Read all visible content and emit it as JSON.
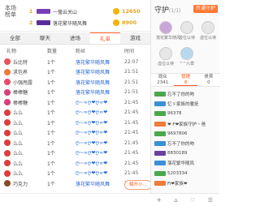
{
  "rank": {
    "title": "本场 榜单",
    "rows": [
      {
        "rank": "1",
        "name": "一憧云关山",
        "score": "12650",
        "badge_color": "#7a3db8"
      },
      {
        "rank": "2",
        "name": "落花繁华随风舞",
        "score": "8900",
        "badge_color": "#5a2e9a"
      }
    ]
  },
  "tabs": [
    {
      "label": "全部",
      "active": false
    },
    {
      "label": "聊天",
      "active": false
    },
    {
      "label": "进场",
      "active": false
    },
    {
      "label": "礼单",
      "active": true
    },
    {
      "label": "游戏",
      "active": false
    }
  ],
  "table": {
    "headers": [
      "礼物",
      "数量",
      "粉丝",
      "时间"
    ],
    "rows": [
      {
        "gift": "丘比特",
        "qty": "1个",
        "sender": "落花繁华随风舞",
        "time": "22:07",
        "icon_color": "#e8505b"
      },
      {
        "gift": "求包养",
        "qty": "1个",
        "sender": "落花繁华随风舞",
        "time": "21:51",
        "icon_color": "#f07a3a"
      },
      {
        "gift": "小强甩露",
        "qty": "1个",
        "sender": "落花繁华随风舞",
        "time": "21:51",
        "icon_color": "#e84a6b"
      },
      {
        "gift": "棒棒糖",
        "qty": "1个",
        "sender": "落花繁华随风舞",
        "time": "21:51",
        "icon_color": "#d93d7a"
      },
      {
        "gift": "棒棒糖",
        "qty": "1个",
        "sender": "ღ~∞ღ❤ღ∞❤",
        "time": "21:45",
        "icon_color": "#d93d7a"
      },
      {
        "gift": "么么",
        "qty": "1个",
        "sender": "ღ~∞ღ❤ღ∞❤",
        "time": "21:45",
        "icon_color": "#e23b3b"
      },
      {
        "gift": "么么",
        "qty": "1个",
        "sender": "ღ~∞ღ❤ღ∞❤",
        "time": "21:45",
        "icon_color": "#e23b3b"
      },
      {
        "gift": "么么",
        "qty": "1个",
        "sender": "ღ~∞ღ❤ღ∞❤",
        "time": "21:45",
        "icon_color": "#e23b3b"
      },
      {
        "gift": "么么",
        "qty": "1个",
        "sender": "ღ~∞ღ❤ღ∞❤",
        "time": "21:45",
        "icon_color": "#e23b3b"
      },
      {
        "gift": "么么",
        "qty": "1个",
        "sender": "ღ~∞ღ❤ღ∞❤",
        "time": "21:45",
        "icon_color": "#e23b3b"
      },
      {
        "gift": "么么",
        "qty": "1个",
        "sender": "ღ~∞ღ❤ღ∞❤",
        "time": "21:45",
        "icon_color": "#e23b3b"
      },
      {
        "gift": "么么",
        "qty": "1个",
        "sender": "ღ~∞ღ❤ღ∞❤",
        "time": "21:45",
        "icon_color": "#e23b3b"
      },
      {
        "gift": "巧克力",
        "qty": "1个",
        "sender": "落花繁华随风舞",
        "time": "21:44",
        "icon_color": "#8a4a2a"
      }
    ],
    "unlock_label": "解开小..."
  },
  "guard": {
    "title": "守护",
    "count": "(1/1)",
    "button": "开通守护",
    "avatars": [
      {
        "name": "落花繁华随风"
      },
      {
        "name": "虚位以待"
      },
      {
        "name": "虚位以待"
      },
      {
        "name": "虚位以待"
      },
      {
        "name": "^^九霄"
      }
    ]
  },
  "right_tabs": [
    {
      "label": "观众",
      "count": "2341",
      "active": false
    },
    {
      "label": "管理",
      "count": "8",
      "active": true
    },
    {
      "label": "贵宾",
      "count": "0",
      "active": false
    }
  ],
  "viewers": [
    {
      "name": "忘不了你的吻",
      "lv_color": "#4aa84a"
    },
    {
      "name": "忆ゞ家族的暖抚",
      "lv_color": "#3b8fd6"
    },
    {
      "name": "96378",
      "lv_color": "#4aa84a"
    },
    {
      "name": "❤ F❤家族守护丶爸",
      "lv_color": "#f07a3a"
    },
    {
      "name": "9697806",
      "lv_color": "#4aa84a"
    },
    {
      "name": "忘不了你的吻",
      "lv_color": "#3b8fd6"
    },
    {
      "name": "8830189",
      "lv_color": "#6b3fa0"
    },
    {
      "name": "落花繁华随风",
      "lv_color": "#3b8fd6"
    },
    {
      "name": "5203334",
      "lv_color": "#4aa84a"
    },
    {
      "name": "Fi❤家族❤",
      "lv_color": "#f07a3a"
    }
  ],
  "footer": [
    "✈",
    "⌂",
    "♡",
    "☰"
  ]
}
